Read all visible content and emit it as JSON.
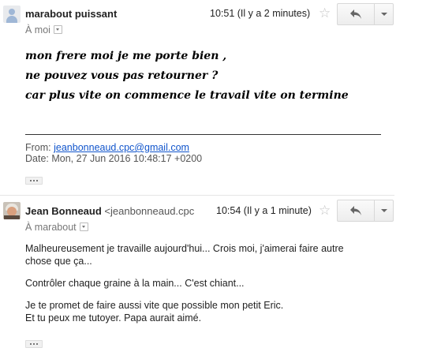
{
  "messages": [
    {
      "sender": "marabout puissant",
      "time": "10:51 (Il y a 2 minutes)",
      "to": "À moi",
      "body_lines": [
        "mon frere moi je me porte bien ,",
        "ne pouvez vous pas retourner ?",
        "car plus vite on commence le travail vite on termine"
      ],
      "quote": {
        "from_label": "From:",
        "from_email": "jeanbonneaud.cpc@gmail.com",
        "date_line": "Date: Mon, 27 Jun 2016 10:48:17 +0200"
      }
    },
    {
      "sender": "Jean Bonneaud",
      "sender_email": "<jeanbonneaud.cpc",
      "time": "10:54 (Il y a 1 minute)",
      "to": "À marabout",
      "body_lines": [
        "Malheureusement je travaille aujourd'hui... Crois moi, j'aimerai faire autre",
        "chose que ça...",
        "Contrôler chaque graine à la main... C'est chiant...",
        "Je te promet de faire aussi vite que possible mon petit Eric.",
        "Et tu peux me tutoyer. Papa aurait aimé."
      ]
    }
  ],
  "icons": {
    "star": "☆",
    "reply": "reply-arrow-icon",
    "more": "chevron-down-icon"
  }
}
